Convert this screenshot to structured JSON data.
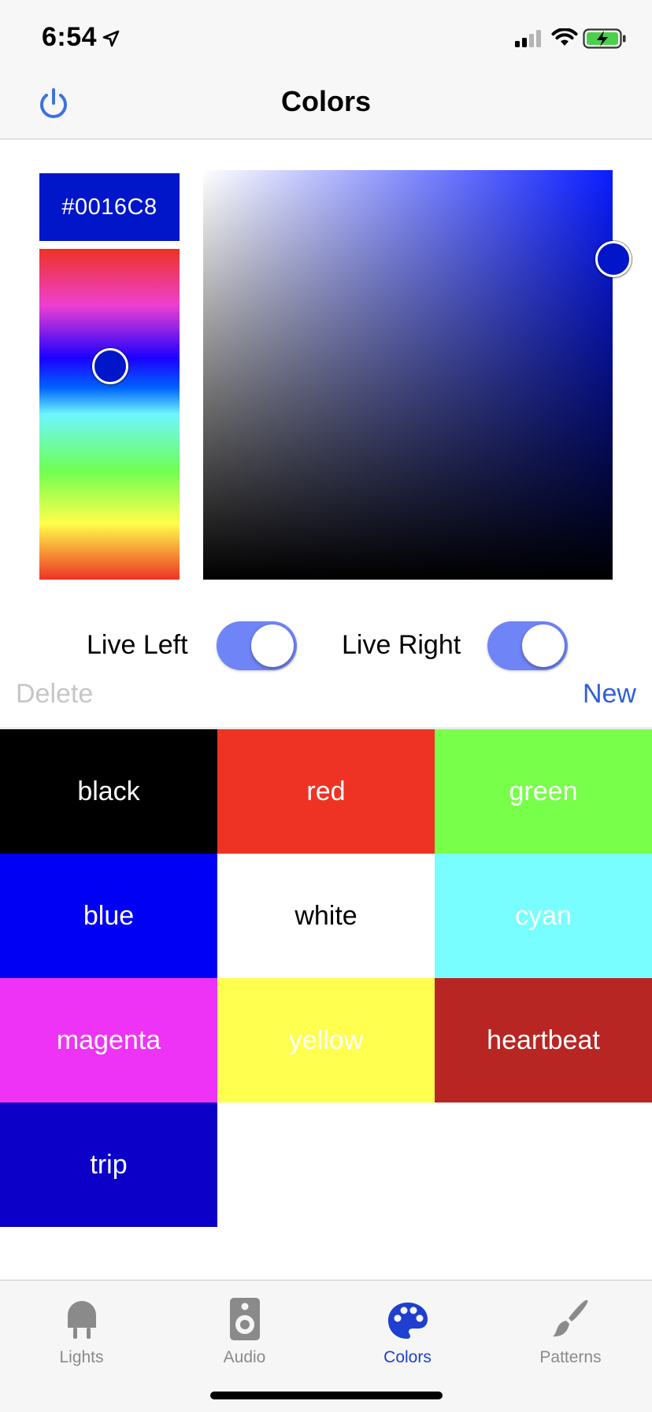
{
  "status_bar": {
    "time": "6:54",
    "icons": [
      "location-arrow-icon",
      "cellular-signal-icon",
      "wifi-icon",
      "battery-charging-icon"
    ]
  },
  "nav": {
    "title": "Colors",
    "left_icon": "power-icon"
  },
  "picker": {
    "hex": "#0016C8",
    "selected_color": "#0016C8"
  },
  "toggles": {
    "live_left": {
      "label": "Live Left",
      "on": true
    },
    "live_right": {
      "label": "Live Right",
      "on": true
    }
  },
  "actions": {
    "delete_label": "Delete",
    "new_label": "New"
  },
  "swatches": [
    {
      "name": "black",
      "color": "#000000",
      "text_color": "#ffffff"
    },
    {
      "name": "red",
      "color": "#EE3325",
      "text_color": "#ffffff"
    },
    {
      "name": "green",
      "color": "#78FF4A",
      "text_color": "#ffffff"
    },
    {
      "name": "blue",
      "color": "#0000F5",
      "text_color": "#ffffff"
    },
    {
      "name": "white",
      "color": "#FFFFFF",
      "text_color": "#000000"
    },
    {
      "name": "cyan",
      "color": "#78FEFE",
      "text_color": "#ffffff"
    },
    {
      "name": "magenta",
      "color": "#EE33F6",
      "text_color": "#ffffff"
    },
    {
      "name": "yellow",
      "color": "#FFFF50",
      "text_color": "#ffffff"
    },
    {
      "name": "heartbeat",
      "color": "#B72623",
      "text_color": "#ffffff"
    },
    {
      "name": "trip",
      "color": "#0C00C8",
      "text_color": "#ffffff"
    }
  ],
  "tabbar": {
    "tabs": [
      {
        "label": "Lights",
        "icon": "bulb-icon",
        "active": false
      },
      {
        "label": "Audio",
        "icon": "speaker-icon",
        "active": false
      },
      {
        "label": "Colors",
        "icon": "palette-icon",
        "active": true
      },
      {
        "label": "Patterns",
        "icon": "brush-icon",
        "active": false
      }
    ],
    "active_color": "#1E3FCF",
    "inactive_color": "#8A8A8A"
  }
}
